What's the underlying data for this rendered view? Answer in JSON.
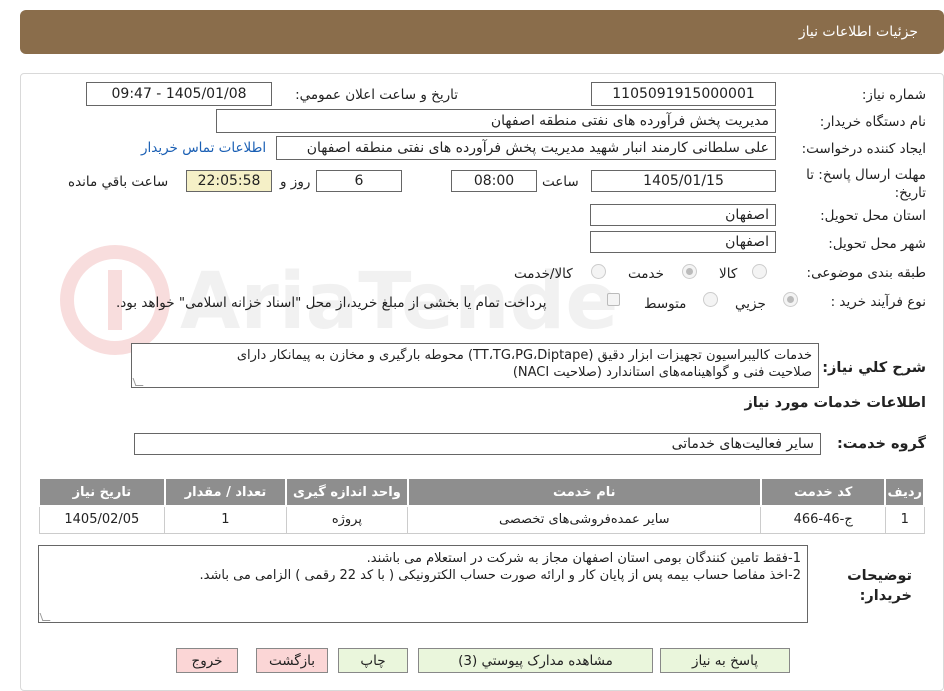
{
  "header": {
    "title": "جزئيات اطلاعات نياز"
  },
  "form": {
    "need_number_label": "شماره نياز:",
    "need_number": "1105091915000001",
    "announce_label": "تاريخ و ساعت اعلان عمومي:",
    "announce_value": "1405/01/08 - 09:47",
    "buyer_org_label": "نام دستگاه خريدار:",
    "buyer_org": "مديريت پخش فرآورده هاى نفتى منطقه اصفهان",
    "creator_label": "ايجاد کننده درخواست:",
    "creator": "على سلطانى کارمند انبار شهيد مديريت پخش فرآورده هاى نفتى منطقه اصفهان",
    "contact_link": "اطلاعات تماس خريدار",
    "deadline_label": "مهلت ارسال پاسخ: تا تاريخ:",
    "deadline_date": "1405/01/15",
    "time_label": "ساعت",
    "deadline_time": "08:00",
    "days_value": "6",
    "days_label": "روز و",
    "remaining_time": "22:05:58",
    "remaining_label": "ساعت باقي مانده",
    "province_label": "استان محل تحويل:",
    "province": "اصفهان",
    "city_label": "شهر محل تحويل:",
    "city": "اصفهان",
    "category_label": "طبقه بندى موضوعى:",
    "category_options": [
      "کالا",
      "خدمت",
      "کالا/خدمت"
    ],
    "category_selected": "خدمت",
    "process_label": "نوع فرآيند خريد :",
    "process_options": [
      "جزيي",
      "متوسط"
    ],
    "process_selected": "جزيي",
    "payment_note": "پرداخت تمام يا بخشى از مبلغ خريد،از محل \"اسناد خزانه اسلامى\" خواهد بود."
  },
  "summary": {
    "label": "شرح کلي نياز:",
    "line1": "خدمات کاليبراسيون تجهيزات ابزار دقيق (TT،TG،PG،Diptape)  محوطه بارگيرى و مخازن به پيمانکار داراى",
    "line2": "صلاحيت فنى و گواهينامه‌هاى استاندارد (صلاحيت NACI)"
  },
  "services": {
    "section_title": "اطلاعات خدمات مورد نياز",
    "group_label": "گروه خدمت:",
    "group_value": "ساير فعاليت‌هاى خدماتى",
    "columns": [
      "رديف",
      "کد خدمت",
      "نام خدمت",
      "واحد اندازه گيرى",
      "تعداد / مقدار",
      "تاريخ نياز"
    ],
    "rows": [
      [
        "1",
        "ج-46-466",
        "ساير عمده‌فروشى‌هاى تخصصى",
        "پروژه",
        "1",
        "1405/02/05"
      ]
    ]
  },
  "notes": {
    "label": "توضيحات خريدار:",
    "line1": "1-فقط تامين کنندگان بومى استان اصفهان مجاز به شرکت در استعلام مى باشند.",
    "line2": "2-اخذ مفاصا حساب بيمه پس از پايان کار و ارائه صورت حساب الکترونيکى ( با کد 22 رقمى ) الزامى مى باشد."
  },
  "buttons": {
    "reply": "پاسخ به نياز",
    "attachments": "مشاهده مدارک پيوستي (3)",
    "print": "چاپ",
    "back": "بازگشت",
    "exit": "خروج"
  },
  "colors": {
    "header_bg": "#8a6d4b",
    "link": "#1a5fb4",
    "time_bg": "#f5f0c7",
    "button_bg": "#eaf6dc",
    "button_pink": "#fbd6d6",
    "table_header": "#8e8e8e"
  }
}
